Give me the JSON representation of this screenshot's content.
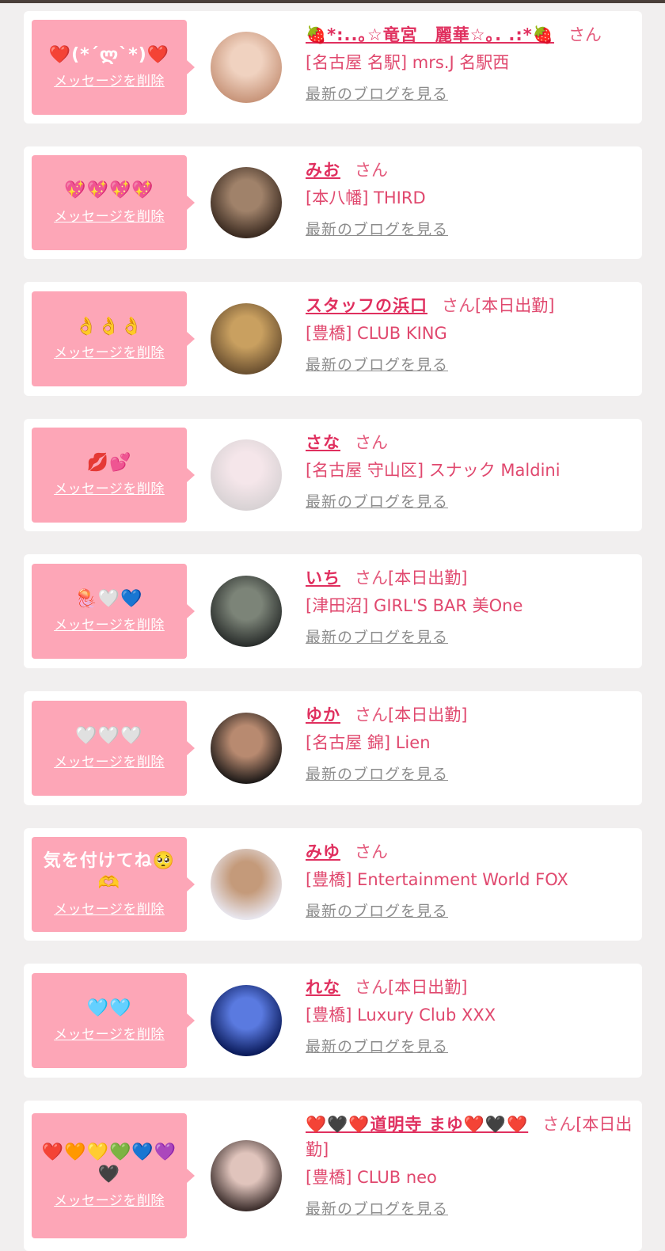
{
  "ui": {
    "delete_label": "メッセージを削除",
    "blog_label": "最新のブログを見る",
    "san_label": "さん",
    "today_label": "[本日出勤]"
  },
  "entries": [
    {
      "message": "❤️(*´ლ`*)❤️",
      "name": "🍓*:..｡☆竜宮　麗華☆｡. .:*🍓",
      "today": false,
      "store": "[名古屋 名駅] mrs.J 名駅西",
      "avatar_colors": [
        "#c8957a",
        "#f0d2c0"
      ]
    },
    {
      "message": "💖💖💖💖",
      "name": "みお",
      "today": false,
      "store": "[本八幡] THIRD",
      "avatar_colors": [
        "#3a2a20",
        "#a0826a"
      ]
    },
    {
      "message": "👌👌👌",
      "name": "スタッフの浜口",
      "today": true,
      "store": "[豊橋] CLUB KING",
      "avatar_colors": [
        "#6b5030",
        "#c9a060"
      ]
    },
    {
      "message": "💋💕",
      "name": "さな",
      "today": false,
      "store": "[名古屋 守山区] スナック Maldini",
      "avatar_colors": [
        "#d8d2d4",
        "#f5e6ea"
      ]
    },
    {
      "message": "🪼🤍💙",
      "name": "いち",
      "today": true,
      "store": "[津田沼] GIRL'S BAR 美One",
      "avatar_colors": [
        "#2a2e2c",
        "#7c8478"
      ]
    },
    {
      "message": "🤍🤍🤍",
      "name": "ゆか",
      "today": true,
      "store": "[名古屋 錦] Lien",
      "avatar_colors": [
        "#1e1a18",
        "#b88a70"
      ]
    },
    {
      "message": "気を付けてね🥺🫶",
      "name": "みゆ",
      "today": false,
      "store": "[豊橋] Entertainment World FOX",
      "avatar_colors": [
        "#e8e6ee",
        "#c49a7a"
      ]
    },
    {
      "message": "🩵🩵",
      "name": "れな",
      "today": true,
      "store": "[豊橋] Luxury Club XXX",
      "avatar_colors": [
        "#0a1a5a",
        "#5a7ae0"
      ]
    },
    {
      "message": "❤️🧡💛💚💙💜🖤",
      "name": "❤️🖤❤️道明寺 まゆ❤️🖤❤️",
      "today": true,
      "store": "[豊橋] CLUB neo",
      "avatar_colors": [
        "#3c2e2c",
        "#e0c4bc"
      ]
    }
  ]
}
